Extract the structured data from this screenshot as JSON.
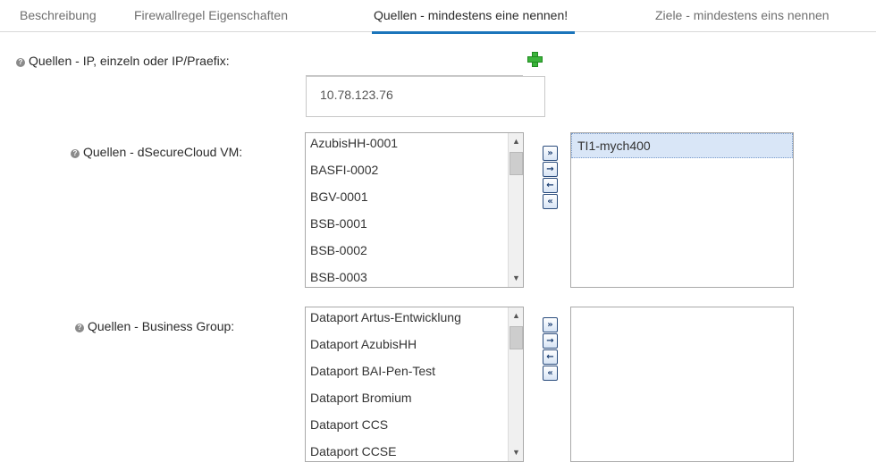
{
  "tabs": [
    {
      "label": "Beschreibung"
    },
    {
      "label": "Firewallregel Eigenschaften"
    },
    {
      "label": "Quellen - mindestens eine nennen!"
    },
    {
      "label": "Ziele - mindestens eins nennen"
    }
  ],
  "active_tab": 2,
  "ip_section": {
    "label": "Quellen - IP, einzeln oder IP/Praefix:",
    "value": "10.78.123.76",
    "add_icon": "plus-icon"
  },
  "vm_section": {
    "label": "Quellen - dSecureCloud VM:",
    "available": [
      "AzubisHH-0001",
      "BASFI-0002",
      "BGV-0001",
      "BSB-0001",
      "BSB-0002",
      "BSB-0003"
    ],
    "selected": [
      "TI1-mych400"
    ]
  },
  "bg_section": {
    "label": "Quellen - Business Group:",
    "available": [
      "Dataport Artus-Entwicklung",
      "Dataport AzubisHH",
      "Dataport BAI-Pen-Test",
      "Dataport Bromium",
      "Dataport CCS",
      "Dataport CCSE"
    ],
    "selected": []
  },
  "move_buttons": {
    "add_all": "»",
    "add": "→",
    "remove": "←",
    "remove_all": "«"
  },
  "colors": {
    "accent": "#1b75bb",
    "add_green": "#3bb33b",
    "selection": "#d9e6f7"
  }
}
